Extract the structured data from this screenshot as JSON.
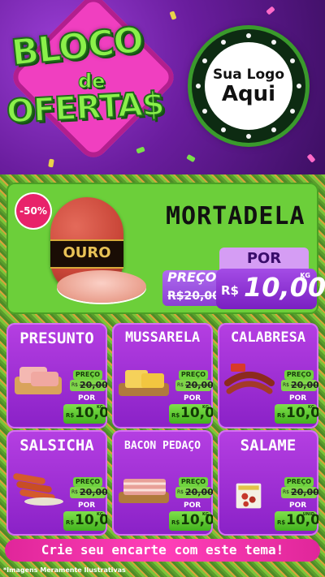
{
  "header": {
    "title_line1": "BLOCO",
    "title_line2": "de",
    "title_line3": "OFERTA$",
    "logo_line1": "Sua Logo",
    "logo_line2": "Aqui"
  },
  "hero": {
    "discount": "-50%",
    "brand": "OURO",
    "product": "MORTADELA",
    "preco_label": "PREÇO",
    "old_currency": "R$",
    "old_price": "20,00",
    "por_label": "POR",
    "new_currency": "R$",
    "new_price": "10,00",
    "unit": "KG"
  },
  "products": [
    {
      "name": "PRESUNTO",
      "preco_label": "PREÇO",
      "old_currency": "R$",
      "old_price": "20,00",
      "por_label": "POR",
      "new_currency": "R$",
      "new_price": "10,00",
      "unit": "KG",
      "icon": "ham-slices-icon"
    },
    {
      "name": "MUSSARELA",
      "preco_label": "PREÇO",
      "old_currency": "R$",
      "old_price": "20,00",
      "por_label": "POR",
      "new_currency": "R$",
      "new_price": "10,00",
      "unit": "KG",
      "icon": "cheese-icon"
    },
    {
      "name": "CALABRESA",
      "preco_label": "PREÇO",
      "old_currency": "R$",
      "old_price": "20,00",
      "por_label": "POR",
      "new_currency": "R$",
      "new_price": "10,00",
      "unit": "KG",
      "icon": "sausage-icon"
    },
    {
      "name": "SALSICHA",
      "preco_label": "PREÇO",
      "old_currency": "R$",
      "old_price": "20,00",
      "por_label": "POR",
      "new_currency": "R$",
      "new_price": "10,00",
      "unit": "KG",
      "icon": "hotdog-sausage-icon"
    },
    {
      "name": "BACON PEDAÇO",
      "preco_label": "PREÇO",
      "old_currency": "R$",
      "old_price": "20,00",
      "por_label": "POR",
      "new_currency": "R$",
      "new_price": "10,00",
      "unit": "KG",
      "icon": "bacon-icon"
    },
    {
      "name": "SALAME",
      "preco_label": "PREÇO",
      "old_currency": "R$",
      "old_price": "20,00",
      "por_label": "POR",
      "new_currency": "R$",
      "new_price": "10,00",
      "unit": "UNID",
      "icon": "salami-pack-icon"
    }
  ],
  "footer": {
    "cta": "Crie seu encarte com este tema!",
    "disclaimer": "*Imagens Meramente Ilustrativas"
  },
  "colors": {
    "purple": "#8a21c7",
    "green": "#6ccf3a",
    "pink": "#e0269a",
    "title_green": "#8af04a"
  }
}
